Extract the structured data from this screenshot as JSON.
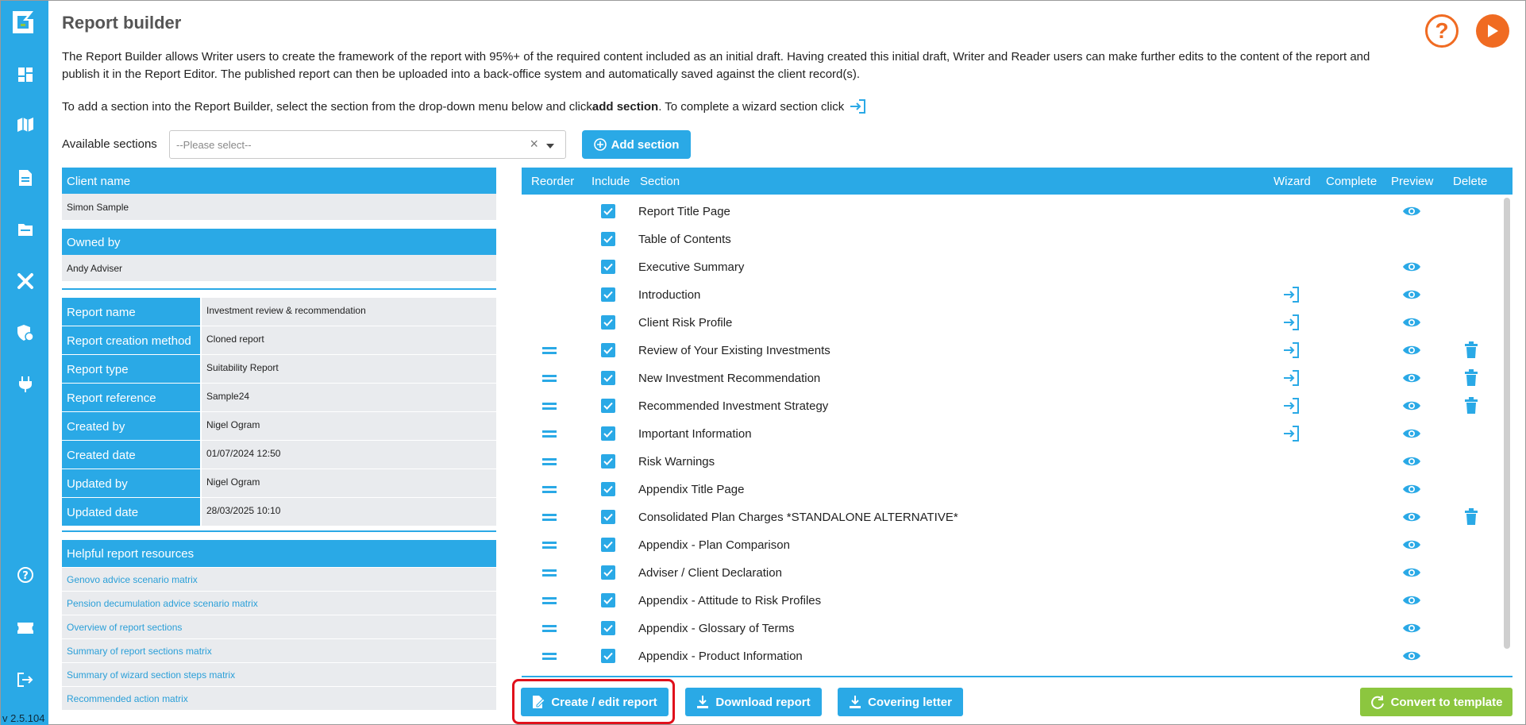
{
  "app": {
    "title": "Report builder",
    "version": "v 2.5.104"
  },
  "sidebar": {
    "items": [
      {
        "icon": "dashboard-icon"
      },
      {
        "icon": "book-map-icon"
      },
      {
        "icon": "document-icon"
      },
      {
        "icon": "folder-icon"
      },
      {
        "icon": "tools-icon"
      },
      {
        "icon": "shield-icon"
      },
      {
        "icon": "plug-icon"
      },
      {
        "icon": "help-circle-icon"
      },
      {
        "icon": "ticket-icon"
      },
      {
        "icon": "logout-icon"
      }
    ]
  },
  "intro": {
    "paragraph": "The Report Builder allows Writer users to create the framework of the report with 95%+ of the required content included as an initial draft. Having created this initial draft, Writer and Reader users can make further edits to the content of the report and publish it in the Report Editor. The published report can then be uploaded into a back-office system and automatically saved against the client record(s).",
    "line2_prefix": "To add a section into the Report Builder, select the section from the drop-down menu below and click ",
    "line2_bold": "add section",
    "line2_suffix": ". To complete a wizard section click"
  },
  "available": {
    "label": "Available sections",
    "placeholder": "--Please select--",
    "add_button": "Add section"
  },
  "client": {
    "name_label": "Client name",
    "name_value": "Simon Sample",
    "owner_label": "Owned by",
    "owner_value": "Andy Adviser"
  },
  "details": [
    {
      "key": "Report name",
      "value": "Investment review & recommendation"
    },
    {
      "key": "Report creation method",
      "value": "Cloned report"
    },
    {
      "key": "Report type",
      "value": "Suitability Report"
    },
    {
      "key": "Report reference",
      "value": "Sample24"
    },
    {
      "key": "Created by",
      "value": "Nigel Ogram"
    },
    {
      "key": "Created date",
      "value": "01/07/2024 12:50"
    },
    {
      "key": "Updated by",
      "value": "Nigel Ogram"
    },
    {
      "key": "Updated date",
      "value": "28/03/2025 10:10"
    }
  ],
  "resources": {
    "header": "Helpful report resources",
    "links": [
      "Genovo advice scenario matrix",
      "Pension decumulation advice scenario matrix",
      "Overview of report sections",
      "Summary of report sections matrix",
      "Summary of wizard section steps matrix",
      "Recommended action matrix"
    ]
  },
  "table": {
    "headers": {
      "reorder": "Reorder",
      "include": "Include",
      "section": "Section",
      "wizard": "Wizard",
      "complete": "Complete",
      "preview": "Preview",
      "delete": "Delete"
    },
    "rows": [
      {
        "label": "Report Title Page",
        "reorder": false,
        "wizard": false,
        "preview": true,
        "delete": false,
        "included": true
      },
      {
        "label": "Table of Contents",
        "reorder": false,
        "wizard": false,
        "preview": false,
        "delete": false,
        "included": true
      },
      {
        "label": "Executive Summary",
        "reorder": false,
        "wizard": false,
        "preview": true,
        "delete": false,
        "included": true
      },
      {
        "label": "Introduction",
        "reorder": false,
        "wizard": true,
        "preview": true,
        "delete": false,
        "included": true
      },
      {
        "label": "Client Risk Profile",
        "reorder": false,
        "wizard": true,
        "preview": true,
        "delete": false,
        "included": true
      },
      {
        "label": "Review of Your Existing Investments",
        "reorder": true,
        "wizard": true,
        "preview": true,
        "delete": true,
        "included": true
      },
      {
        "label": "New Investment Recommendation",
        "reorder": true,
        "wizard": true,
        "preview": true,
        "delete": true,
        "included": true
      },
      {
        "label": "Recommended Investment Strategy",
        "reorder": true,
        "wizard": true,
        "preview": true,
        "delete": true,
        "included": true
      },
      {
        "label": "Important Information",
        "reorder": true,
        "wizard": true,
        "preview": true,
        "delete": false,
        "included": true
      },
      {
        "label": "Risk Warnings",
        "reorder": true,
        "wizard": false,
        "preview": true,
        "delete": false,
        "included": true
      },
      {
        "label": "Appendix Title Page",
        "reorder": true,
        "wizard": false,
        "preview": true,
        "delete": false,
        "included": true
      },
      {
        "label": "Consolidated Plan Charges *STANDALONE ALTERNATIVE*",
        "reorder": true,
        "wizard": false,
        "preview": true,
        "delete": true,
        "included": true
      },
      {
        "label": "Appendix - Plan Comparison",
        "reorder": true,
        "wizard": false,
        "preview": true,
        "delete": false,
        "included": true
      },
      {
        "label": "Adviser / Client Declaration",
        "reorder": true,
        "wizard": false,
        "preview": true,
        "delete": false,
        "included": true
      },
      {
        "label": "Appendix - Attitude to Risk Profiles",
        "reorder": true,
        "wizard": false,
        "preview": true,
        "delete": false,
        "included": true
      },
      {
        "label": "Appendix - Glossary of Terms",
        "reorder": true,
        "wizard": false,
        "preview": true,
        "delete": false,
        "included": true
      },
      {
        "label": "Appendix - Product Information",
        "reorder": true,
        "wizard": false,
        "preview": true,
        "delete": false,
        "included": true
      }
    ]
  },
  "actions": {
    "create_edit": "Create / edit report",
    "download": "Download report",
    "covering": "Covering letter",
    "convert": "Convert to template"
  },
  "colors": {
    "accent": "#2aa9e6",
    "orange": "#f06b22",
    "green": "#8cc63f",
    "highlight": "#e0101b"
  }
}
